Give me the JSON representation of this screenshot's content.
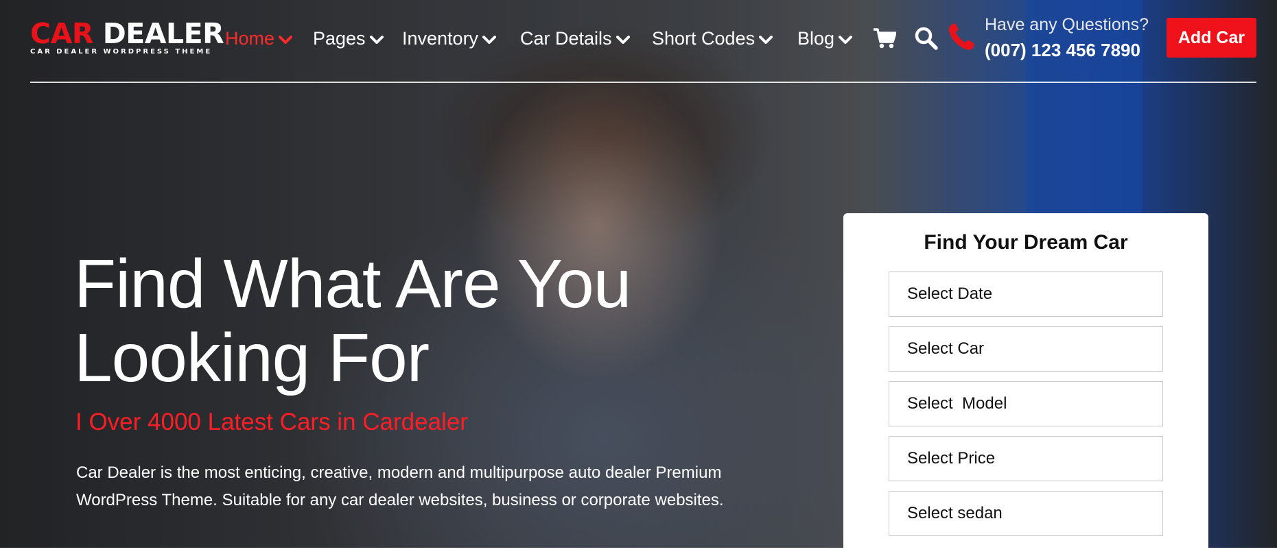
{
  "brand": {
    "logo_red": "CAR",
    "logo_white": "DEALER",
    "logo_sub": "CAR DEALER WORDPRESS THEME"
  },
  "nav": [
    {
      "label": "Home",
      "active": true
    },
    {
      "label": "Pages",
      "active": false
    },
    {
      "label": "Inventory",
      "active": false
    },
    {
      "label": "Car Details",
      "active": false
    },
    {
      "label": "Short Codes",
      "active": false
    },
    {
      "label": "Blog",
      "active": false
    }
  ],
  "header": {
    "icons": [
      "cart-icon",
      "search-icon",
      "phone-icon"
    ],
    "question_label": "Have any Questions?",
    "phone_number": "(007) 123 456 7890",
    "add_car_label": "Add Car"
  },
  "hero": {
    "headline_line1": "Find What Are You",
    "headline_line2": "Looking For",
    "tagline": "I Over 4000 Latest Cars in Cardealer",
    "description": "Car Dealer is the most enticing, creative, modern and multipurpose auto dealer Premium WordPress Theme. Suitable for any car dealer websites, business or corporate websites."
  },
  "search_card": {
    "title": "Find Your Dream Car",
    "fields": [
      "Select Date",
      "Select Car",
      "Select  Model",
      "Select Price",
      "Select sedan"
    ]
  },
  "colors": {
    "accent_red": "#e8121a",
    "button_red": "#f0121b",
    "nav_active": "#ff2a2a",
    "card_bg": "#ffffff"
  }
}
